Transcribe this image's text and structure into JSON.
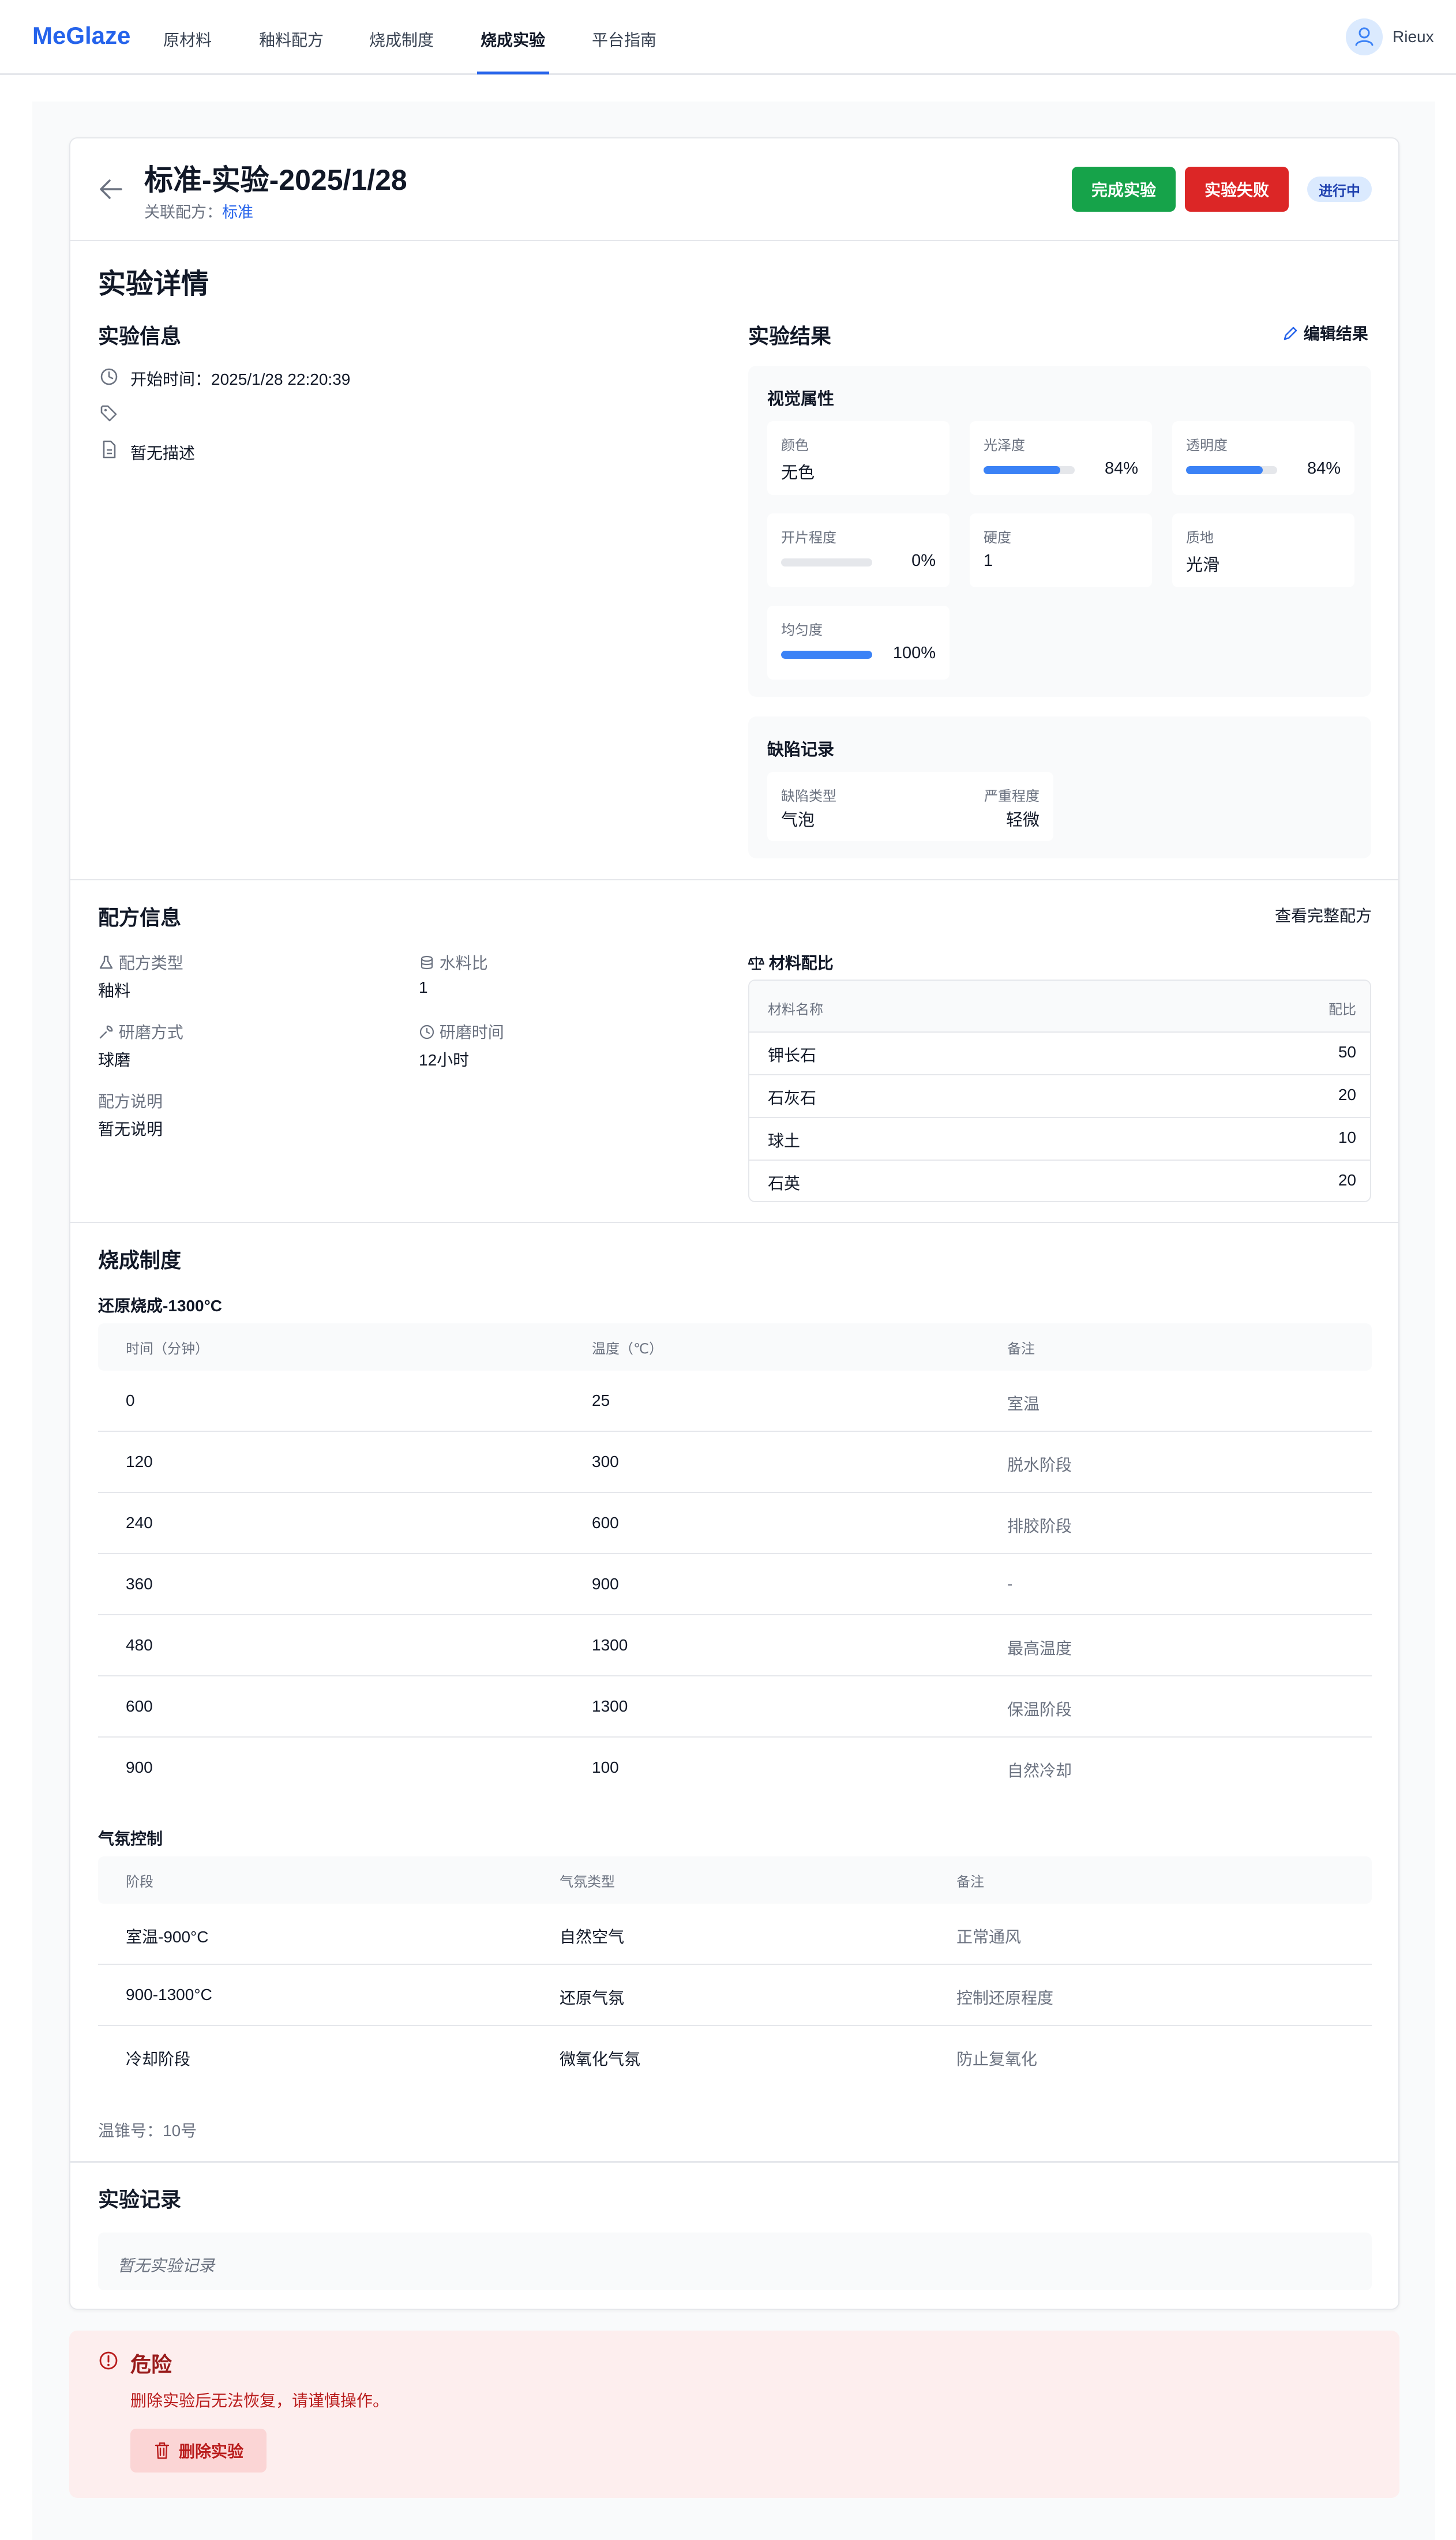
{
  "nav": {
    "logo": "MeGlaze",
    "items": [
      "原材料",
      "釉料配方",
      "烧成制度",
      "烧成实验",
      "平台指南"
    ],
    "active_index": 3,
    "user_name": "Rieux"
  },
  "header": {
    "title": "标准-实验-2025/1/28",
    "recipe_label": "关联配方：",
    "recipe_link": "标准",
    "complete_button": "完成实验",
    "fail_button": "实验失败",
    "status_badge": "进行中",
    "colors": {
      "complete": "#16a34a",
      "fail": "#dc2626",
      "accent": "#2563eb"
    }
  },
  "details": {
    "section_title": "实验详情",
    "info_title": "实验信息",
    "start_time_label": "开始时间：",
    "start_time": "2025/1/28 22:20:39",
    "description": "暂无描述",
    "result_title": "实验结果",
    "edit_result": "编辑结果",
    "visual_title": "视觉属性",
    "visual": {
      "color_label": "颜色",
      "color_value": "无色",
      "gloss_label": "光泽度",
      "gloss_value": "84%",
      "gloss_fraction": 0.84,
      "transparency_label": "透明度",
      "transparency_value": "84%",
      "transparency_fraction": 0.84,
      "crackle_label": "开片程度",
      "crackle_value": "0%",
      "crackle_fraction": 0,
      "hardness_label": "硬度",
      "hardness_value": "1",
      "texture_label": "质地",
      "texture_value": "光滑",
      "uniformity_label": "均匀度",
      "uniformity_value": "100%",
      "uniformity_fraction": 1.0
    },
    "defects_title": "缺陷记录",
    "defect_type_label": "缺陷类型",
    "defect_type_value": "气泡",
    "severity_label": "严重程度",
    "severity_value": "轻微"
  },
  "recipe": {
    "section_title": "配方信息",
    "view_full": "查看完整配方",
    "type_label": "配方类型",
    "type_value": "釉料",
    "water_label": "水料比",
    "water_value": "1",
    "grind_label": "研磨方式",
    "grind_value": "球磨",
    "grind_time_label": "研磨时间",
    "grind_time_value": "12小时",
    "note_label": "配方说明",
    "note_value": "暂无说明",
    "materials_title": "材料配比",
    "materials_headers": [
      "材料名称",
      "配比"
    ],
    "materials": [
      {
        "name": "钾长石",
        "ratio": "50"
      },
      {
        "name": "石灰石",
        "ratio": "20"
      },
      {
        "name": "球土",
        "ratio": "10"
      },
      {
        "name": "石英",
        "ratio": "20"
      }
    ]
  },
  "firing": {
    "section_title": "烧成制度",
    "schedule_name": "还原烧成-1300°C",
    "headers": [
      "时间（分钟）",
      "温度（℃）",
      "备注"
    ],
    "rows": [
      {
        "time": "0",
        "temp": "25",
        "note": "室温"
      },
      {
        "time": "120",
        "temp": "300",
        "note": "脱水阶段"
      },
      {
        "time": "240",
        "temp": "600",
        "note": "排胶阶段"
      },
      {
        "time": "360",
        "temp": "900",
        "note": "-"
      },
      {
        "time": "480",
        "temp": "1300",
        "note": "最高温度"
      },
      {
        "time": "600",
        "temp": "1300",
        "note": "保温阶段"
      },
      {
        "time": "900",
        "temp": "100",
        "note": "自然冷却"
      }
    ],
    "atmosphere_title": "气氛控制",
    "atmosphere_headers": [
      "阶段",
      "气氛类型",
      "备注"
    ],
    "atmosphere_rows": [
      {
        "stage": "室温-900°C",
        "type": "自然空气",
        "note": "正常通风"
      },
      {
        "stage": "900-1300°C",
        "type": "还原气氛",
        "note": "控制还原程度"
      },
      {
        "stage": "冷却阶段",
        "type": "微氧化气氛",
        "note": "防止复氧化"
      }
    ],
    "cone": "温锥号：10号"
  },
  "records": {
    "section_title": "实验记录",
    "empty": "暂无实验记录"
  },
  "danger": {
    "title": "危险",
    "message": "删除实验后无法恢复，请谨慎操作。",
    "delete_button": "删除实验"
  }
}
